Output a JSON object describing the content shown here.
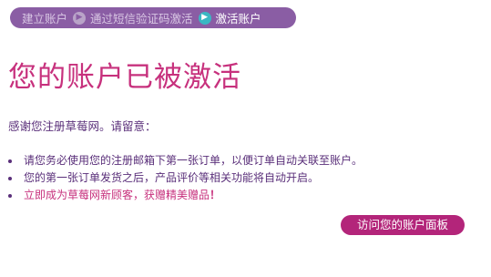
{
  "steps": {
    "items": [
      {
        "label": "建立账户",
        "state": "done"
      },
      {
        "label": "通过短信验证码激活",
        "state": "done"
      },
      {
        "label": "激活账户",
        "state": "active"
      }
    ],
    "arrow_icon": "arrow-right-circle-icon"
  },
  "title": "您的账户已被激活",
  "intro": "感谢您注册草莓网。请留意：",
  "bullets": [
    {
      "text": "请您务必使用您的注册邮箱下第一张订单，以便订单自动关联至账户。"
    },
    {
      "text": "您的第一张订单发货之后，产品评价等相关功能将自动开启。"
    },
    {
      "text": "立即成为草莓网新顾客，获赠精美赠品",
      "suffix": "！"
    }
  ],
  "cta_label": "访问您的账户面板",
  "colors": {
    "brand_purple": "#8a5da4",
    "accent_pink": "#c7317d",
    "text_purple": "#5a2f7a",
    "button_magenta": "#b3257a",
    "step_active_arrow": "#3ab7c3"
  }
}
